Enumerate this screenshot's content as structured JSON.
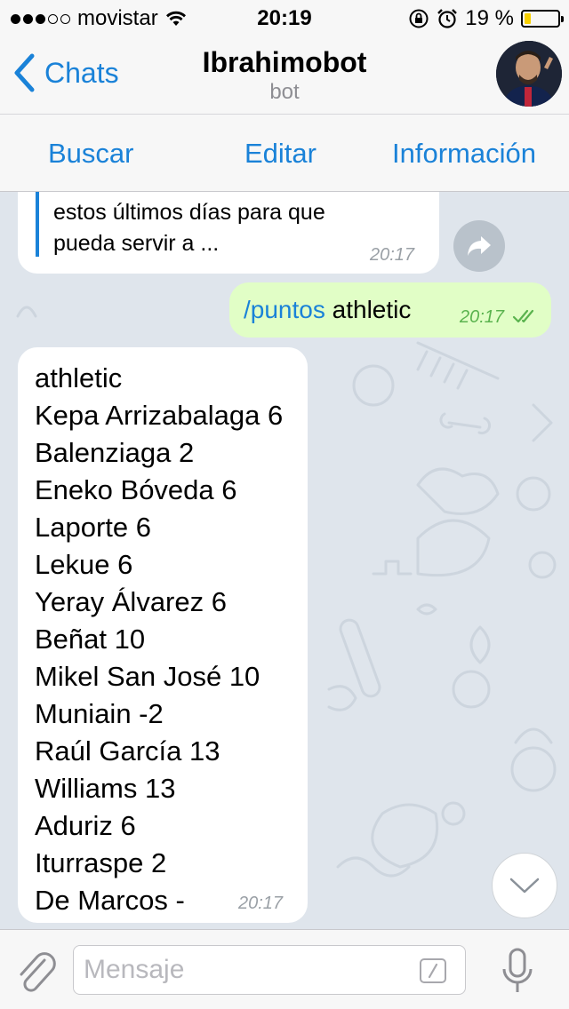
{
  "status_bar": {
    "carrier": "movistar",
    "time": "20:19",
    "battery_text": "19 %",
    "battery_level": 0.19,
    "battery_color": "#f8d000",
    "signal_icons": [
      "signal-dots-icon",
      "wifi-icon",
      "lock-rotation-icon",
      "alarm-icon",
      "battery-icon"
    ]
  },
  "nav": {
    "back_label": "Chats",
    "title": "Ibrahimobot",
    "subtitle": "bot",
    "accent": "#1a82d8"
  },
  "toolbar": {
    "search_label": "Buscar",
    "edit_label": "Editar",
    "info_label": "Información"
  },
  "chat": {
    "messages": [
      {
        "direction": "incoming",
        "lines": [
          "estos últimos días para que",
          "pueda servir a ..."
        ],
        "time": "20:17"
      },
      {
        "direction": "outgoing",
        "command": "/puntos",
        "text": " athletic",
        "time": "20:17"
      },
      {
        "direction": "incoming",
        "lines": [
          "athletic",
          "Kepa Arrizabalaga 6",
          "Balenziaga 2",
          "Eneko Bóveda 6",
          "Laporte 6",
          "Lekue 6",
          "Yeray Álvarez 6",
          "Beñat 10",
          "Mikel San José 10",
          "Muniain -2",
          "Raúl García 13",
          "Williams 13",
          "Aduriz 6",
          "Iturraspe 2",
          "De Marcos -"
        ],
        "time": "20:17"
      }
    ]
  },
  "input": {
    "placeholder": "Mensaje"
  }
}
